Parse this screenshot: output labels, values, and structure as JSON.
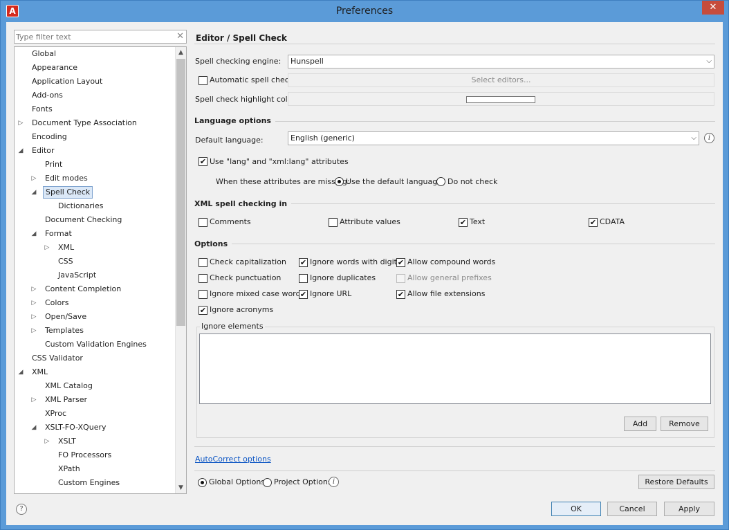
{
  "window": {
    "title": "Preferences",
    "close_glyph": "✕",
    "app_icon": "oxygen-logo-icon",
    "app_icon_letter": "A"
  },
  "filter": {
    "placeholder": "Type filter text",
    "clear_glyph": "✕"
  },
  "tree": {
    "items": [
      {
        "label": "Global",
        "level": 0,
        "arrow": ""
      },
      {
        "label": "Appearance",
        "level": 0,
        "arrow": ""
      },
      {
        "label": "Application Layout",
        "level": 0,
        "arrow": ""
      },
      {
        "label": "Add-ons",
        "level": 0,
        "arrow": ""
      },
      {
        "label": "Fonts",
        "level": 0,
        "arrow": ""
      },
      {
        "label": "Document Type Association",
        "level": 0,
        "arrow": "▷"
      },
      {
        "label": "Encoding",
        "level": 0,
        "arrow": ""
      },
      {
        "label": "Editor",
        "level": 0,
        "arrow": "◢"
      },
      {
        "label": "Print",
        "level": 1,
        "arrow": ""
      },
      {
        "label": "Edit modes",
        "level": 1,
        "arrow": "▷"
      },
      {
        "label": "Spell Check",
        "level": 1,
        "arrow": "◢",
        "selected": true
      },
      {
        "label": "Dictionaries",
        "level": 2,
        "arrow": ""
      },
      {
        "label": "Document Checking",
        "level": 1,
        "arrow": ""
      },
      {
        "label": "Format",
        "level": 1,
        "arrow": "◢"
      },
      {
        "label": "XML",
        "level": 2,
        "arrow": "▷"
      },
      {
        "label": "CSS",
        "level": 2,
        "arrow": ""
      },
      {
        "label": "JavaScript",
        "level": 2,
        "arrow": ""
      },
      {
        "label": "Content Completion",
        "level": 1,
        "arrow": "▷"
      },
      {
        "label": "Colors",
        "level": 1,
        "arrow": "▷"
      },
      {
        "label": "Open/Save",
        "level": 1,
        "arrow": "▷"
      },
      {
        "label": "Templates",
        "level": 1,
        "arrow": "▷"
      },
      {
        "label": "Custom Validation Engines",
        "level": 1,
        "arrow": ""
      },
      {
        "label": "CSS Validator",
        "level": 0,
        "arrow": ""
      },
      {
        "label": "XML",
        "level": 0,
        "arrow": "◢"
      },
      {
        "label": "XML Catalog",
        "level": 1,
        "arrow": ""
      },
      {
        "label": "XML Parser",
        "level": 1,
        "arrow": "▷"
      },
      {
        "label": "XProc",
        "level": 1,
        "arrow": ""
      },
      {
        "label": "XSLT-FO-XQuery",
        "level": 1,
        "arrow": "◢"
      },
      {
        "label": "XSLT",
        "level": 2,
        "arrow": "▷"
      },
      {
        "label": "FO Processors",
        "level": 2,
        "arrow": ""
      },
      {
        "label": "XPath",
        "level": 2,
        "arrow": ""
      },
      {
        "label": "Custom Engines",
        "level": 2,
        "arrow": ""
      }
    ],
    "scroll_up": "▲",
    "scroll_down": "▼"
  },
  "panel": {
    "title": "Editor / Spell Check",
    "engine_label": "Spell checking engine:",
    "engine_value": "Hunspell",
    "auto_check_label": "Automatic spell check:",
    "auto_check_checked": false,
    "select_editors": "Select editors...",
    "highlight_label": "Spell check highlight color:",
    "language_section": "Language options",
    "default_language_label": "Default language:",
    "default_language_value": "English (generic)",
    "use_lang_label": "Use \"lang\" and \"xml:lang\" attributes",
    "use_lang_checked": true,
    "missing_label": "When these attributes are missing:",
    "missing_opt1": "Use the default language",
    "missing_opt2": "Do not check",
    "missing_selected": "Use the default language",
    "xml_section": "XML spell checking in",
    "xml_opts": [
      {
        "label": "Comments",
        "checked": false
      },
      {
        "label": "Attribute values",
        "checked": false
      },
      {
        "label": "Text",
        "checked": true
      },
      {
        "label": "CDATA",
        "checked": true
      }
    ],
    "options_section": "Options",
    "options": [
      {
        "label": "Check capitalization",
        "checked": false,
        "disabled": false
      },
      {
        "label": "Ignore words with digits",
        "checked": true,
        "disabled": false
      },
      {
        "label": "Allow compound words",
        "checked": true,
        "disabled": false
      },
      {
        "label": "Check punctuation",
        "checked": false,
        "disabled": false
      },
      {
        "label": "Ignore duplicates",
        "checked": false,
        "disabled": false
      },
      {
        "label": "Allow general prefixes",
        "checked": false,
        "disabled": true
      },
      {
        "label": "Ignore mixed case words",
        "checked": false,
        "disabled": false
      },
      {
        "label": "Ignore URL",
        "checked": true,
        "disabled": false
      },
      {
        "label": "Allow file extensions",
        "checked": true,
        "disabled": false
      },
      {
        "label": "Ignore acronyms",
        "checked": true,
        "disabled": false
      }
    ],
    "ignore_elements_label": "Ignore elements",
    "add_label": "Add",
    "remove_label": "Remove",
    "autocorrect_link": "AutoCorrect options",
    "global_options_label": "Global Options",
    "project_options_label": "Project Options",
    "scope_selected": "Global Options",
    "restore_defaults": "Restore Defaults"
  },
  "footer": {
    "ok": "OK",
    "cancel": "Cancel",
    "apply": "Apply",
    "help_glyph": "?"
  },
  "check_glyph": "✔",
  "info_glyph": "i",
  "colors": {
    "titlebar": "#5b9bd8",
    "close": "#c74c3c",
    "link": "#0b55c4",
    "selection": "#dbe8f7"
  }
}
